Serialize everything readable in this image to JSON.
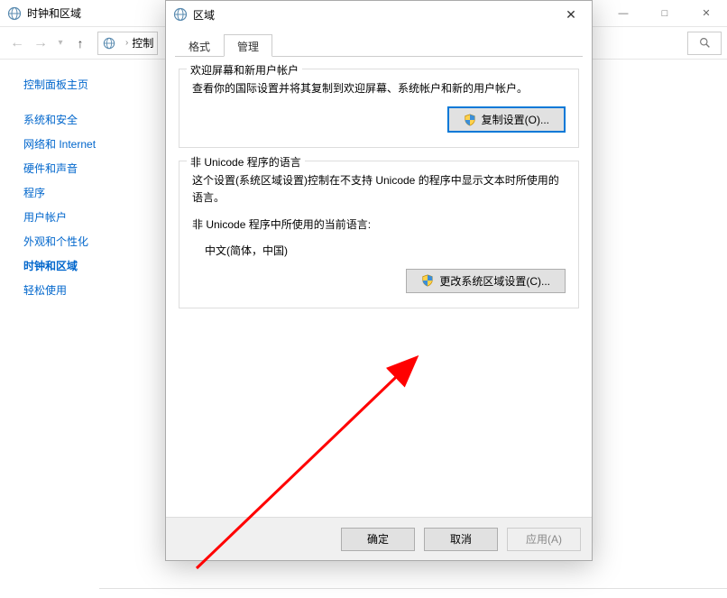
{
  "parent_window": {
    "title": "时钟和区域",
    "breadcrumb": {
      "item1": "控制"
    },
    "sidebar": {
      "main_link": "控制面板主页",
      "items": [
        {
          "label": "系统和安全"
        },
        {
          "label": "网络和 Internet"
        },
        {
          "label": "硬件和声音"
        },
        {
          "label": "程序"
        },
        {
          "label": "用户帐户"
        },
        {
          "label": "外观和个性化"
        },
        {
          "label": "时钟和区域",
          "active": true
        },
        {
          "label": "轻松使用"
        }
      ]
    },
    "wincontrols": {
      "min": "—",
      "max": "□",
      "close": "✕"
    }
  },
  "dialog": {
    "title": "区域",
    "tabs": [
      {
        "label": "格式"
      },
      {
        "label": "管理",
        "active": true
      }
    ],
    "group1": {
      "title": "欢迎屏幕和新用户帐户",
      "text": "查看你的国际设置并将其复制到欢迎屏幕、系统帐户和新的用户帐户。",
      "button": "复制设置(O)..."
    },
    "group2": {
      "title": "非 Unicode 程序的语言",
      "text": "这个设置(系统区域设置)控制在不支持 Unicode 的程序中显示文本时所使用的语言。",
      "label2": "非 Unicode 程序中所使用的当前语言:",
      "value": "中文(简体，中国)",
      "button": "更改系统区域设置(C)..."
    },
    "footer": {
      "ok": "确定",
      "cancel": "取消",
      "apply": "应用(A)"
    },
    "close_glyph": "✕"
  }
}
